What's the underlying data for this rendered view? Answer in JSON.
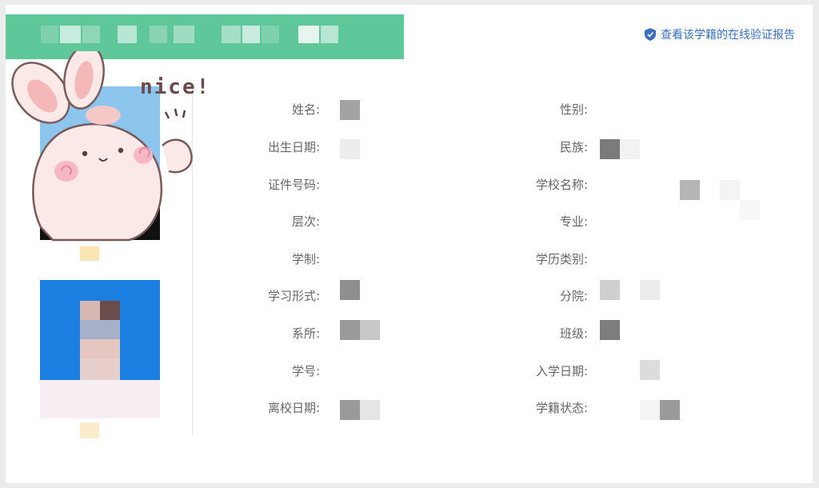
{
  "header": {
    "verify_link": "查看该学籍的在线验证报告",
    "brand_color": "#5fc89b",
    "link_color": "#3a6fc0"
  },
  "sticker": {
    "text": "nice!"
  },
  "fields_left": [
    {
      "label": "姓名:"
    },
    {
      "label": "出生日期:"
    },
    {
      "label": "证件号码:"
    },
    {
      "label": "层次:"
    },
    {
      "label": "学制:"
    },
    {
      "label": "学习形式:"
    },
    {
      "label": "系所:"
    },
    {
      "label": "学号:"
    },
    {
      "label": "离校日期:"
    }
  ],
  "fields_right": [
    {
      "label": "性别:"
    },
    {
      "label": "民族:"
    },
    {
      "label": "学校名称:"
    },
    {
      "label": "专业:"
    },
    {
      "label": "学历类别:"
    },
    {
      "label": "分院:"
    },
    {
      "label": "班级:"
    },
    {
      "label": "入学日期:"
    },
    {
      "label": "学籍状态:"
    }
  ],
  "icons": {
    "verify": "shield-check-icon",
    "sticker": "bunny-sticker-icon"
  }
}
